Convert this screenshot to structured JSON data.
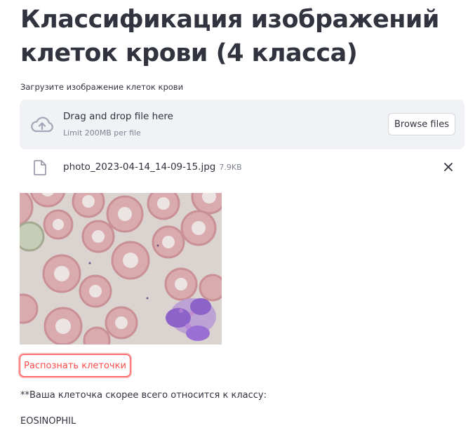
{
  "page": {
    "title": "Классификация изображений клеток крови (4 класса)"
  },
  "uploader": {
    "label": "Загрузите изображение клеток крови",
    "drag_text": "Drag and drop file here",
    "limit_text": "Limit 200MB per file",
    "browse_label": "Browse files",
    "icons": {
      "upload": "cloud-upload-icon",
      "file": "file-icon",
      "remove": "close-icon"
    }
  },
  "uploaded_file": {
    "name": "photo_2023-04-14_14-09-15.jpg",
    "size": "7.9KB"
  },
  "classify_button": {
    "label": "Распознать клеточки"
  },
  "result": {
    "message": "**Ваша клеточка скорее всего относится к классу:",
    "class_name": "EOSINOPHIL"
  },
  "colors": {
    "accent": "#ff4b4b",
    "text": "#31333f",
    "muted": "#808495",
    "dropzone_bg": "#f0f2f6"
  }
}
